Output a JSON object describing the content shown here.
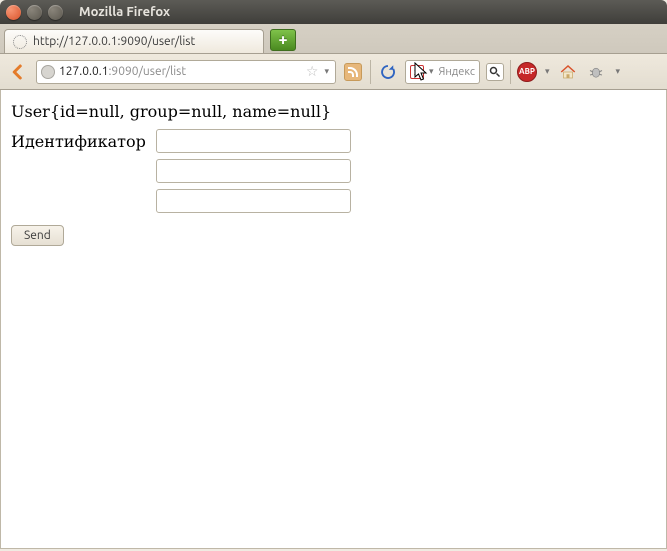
{
  "window": {
    "title": "Mozilla Firefox"
  },
  "tabs": {
    "active_label": "http://127.0.0.1:9090/user/list"
  },
  "urlbar": {
    "prefix": "127.0.0.1",
    "suffix": ":9090/user/list"
  },
  "search": {
    "provider_letter": "Я",
    "placeholder": "Яндекс"
  },
  "abp": {
    "label": "ABP"
  },
  "page": {
    "heading": "User{id=null, group=null, name=null}",
    "labels": {
      "id": "Идентификатор",
      "group": "",
      "name": ""
    },
    "values": {
      "id": "",
      "group": "",
      "name": ""
    },
    "submit": "Send"
  }
}
